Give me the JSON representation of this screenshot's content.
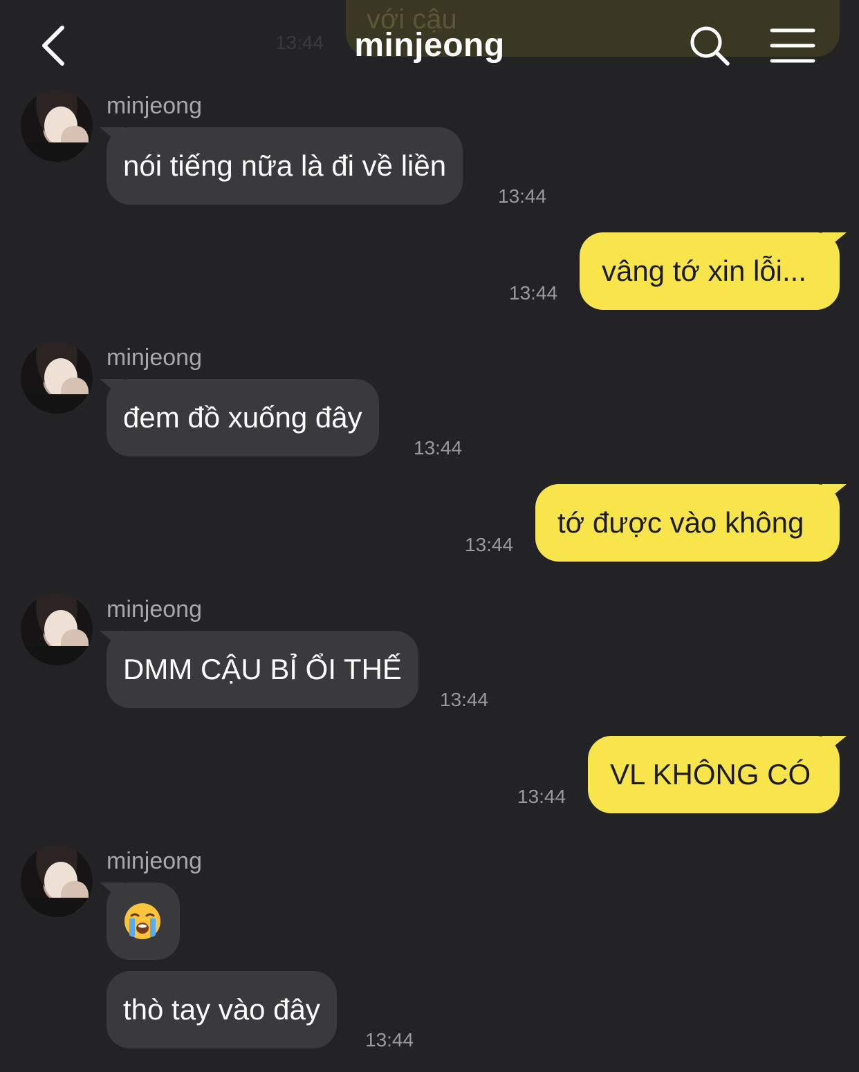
{
  "ghost": {
    "text": "với cậu",
    "time": "13:44"
  },
  "header": {
    "title": "minjeong"
  },
  "messages": [
    {
      "sender": "minjeong",
      "text": "nói tiếng nữa là đi về liền",
      "time": "13:44"
    },
    {
      "text": "vâng tớ xin lỗi...",
      "time": "13:44"
    },
    {
      "sender": "minjeong",
      "text": "đem đồ xuống đây",
      "time": "13:44"
    },
    {
      "text": "tớ được vào không",
      "time": "13:44"
    },
    {
      "sender": "minjeong",
      "text": "DMM CẬU BỈ ỔI THẾ",
      "time": "13:44"
    },
    {
      "text": "VL KHÔNG CÓ",
      "time": "13:44"
    },
    {
      "sender": "minjeong",
      "emoji": "loudly-crying-face"
    },
    {
      "text": "thò tay vào đây",
      "time": "13:44"
    }
  ],
  "colors": {
    "background": "#232325",
    "incoming": "#3a3a3c",
    "outgoing": "#f8e54c"
  }
}
